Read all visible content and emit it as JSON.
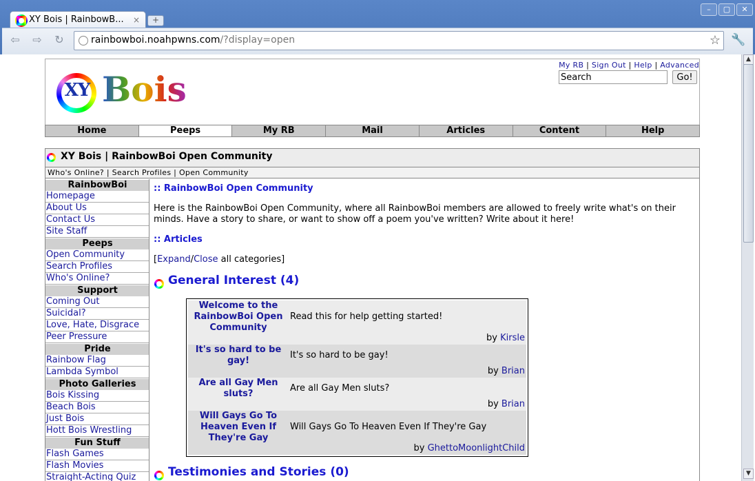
{
  "browser": {
    "tab_title": "XY Bois | RainbowB...",
    "tab_close": "×",
    "new_tab": "+",
    "url_host": "rainbowboi.noahpwns.com",
    "url_path": "/?display=open"
  },
  "header": {
    "logo_xy": "XY",
    "logo_bois": "Bois",
    "top_links": [
      "My RB",
      "Sign Out",
      "Help",
      "Advanced"
    ],
    "search_placeholder": "Search",
    "go_label": "Go!"
  },
  "main_nav": [
    "Home",
    "Peeps",
    "My RB",
    "Mail",
    "Articles",
    "Content",
    "Help"
  ],
  "main_nav_active": "Peeps",
  "section": {
    "title": "XY Bois | RainbowBoi Open Community",
    "crumbs": "Who's Online? | Search Profiles | Open Community"
  },
  "sidebar": [
    {
      "head": "RainbowBoi",
      "items": [
        "Homepage",
        "About Us",
        "Contact Us",
        "Site Staff"
      ]
    },
    {
      "head": "Peeps",
      "items": [
        "Open Community",
        "Search Profiles",
        "Who's Online?"
      ]
    },
    {
      "head": "Support",
      "items": [
        "Coming Out",
        "Suicidal?",
        "Love, Hate, Disgrace",
        "Peer Pressure"
      ]
    },
    {
      "head": "Pride",
      "items": [
        "Rainbow Flag",
        "Lambda Symbol"
      ]
    },
    {
      "head": "Photo Galleries",
      "items": [
        "Bois Kissing",
        "Beach Bois",
        "Just Bois",
        "Hott Bois Wrestling"
      ]
    },
    {
      "head": "Fun Stuff",
      "items": [
        "Flash Games",
        "Flash Movies",
        "Straight-Acting Quiz"
      ]
    }
  ],
  "content": {
    "heading": ":: RainbowBoi Open Community",
    "intro_line1": "Here is the RainbowBoi Open Community, where all RainbowBoi members are allowed to freely write what's on their",
    "intro_line2": "minds. Have a story to share, or want to show off a poem you've written? Write about it here!",
    "articles_heading": ":: Articles",
    "expand_open": "[",
    "expand_label": "Expand",
    "expand_sep": "/",
    "close_label": "Close",
    "expand_rest": " all categories]",
    "category1": "General Interest (4)",
    "category2": "Testimonies and Stories (0)",
    "by_label": "by",
    "articles": [
      {
        "title": "Welcome to the RainbowBoi Open Community",
        "desc": "Read this for help getting started!",
        "author": "Kirsle"
      },
      {
        "title": "It's so hard to be gay!",
        "desc": "It's so hard to be gay!",
        "author": "Brian"
      },
      {
        "title": "Are all Gay Men sluts?",
        "desc": "Are all Gay Men sluts?",
        "author": "Brian"
      },
      {
        "title": "Will Gays Go To Heaven Even If They're Gay",
        "desc": "Will Gays Go To Heaven Even If They're Gay",
        "author": "GhettoMoonlightChild"
      }
    ]
  }
}
